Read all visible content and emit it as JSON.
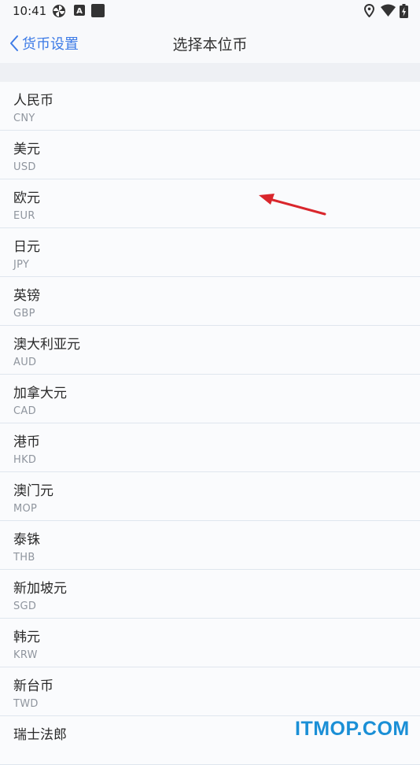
{
  "status": {
    "time": "10:41",
    "icons": [
      "pinwheel-icon",
      "a-badge-icon",
      "square-icon",
      "location-icon",
      "wifi-icon",
      "battery-charging-icon"
    ]
  },
  "nav": {
    "back_label": "货币设置",
    "title": "选择本位币"
  },
  "currencies": [
    {
      "name": "人民币",
      "code": "CNY"
    },
    {
      "name": "美元",
      "code": "USD"
    },
    {
      "name": "欧元",
      "code": "EUR"
    },
    {
      "name": "日元",
      "code": "JPY"
    },
    {
      "name": "英镑",
      "code": "GBP"
    },
    {
      "name": "澳大利亚元",
      "code": "AUD"
    },
    {
      "name": "加拿大元",
      "code": "CAD"
    },
    {
      "name": "港币",
      "code": "HKD"
    },
    {
      "name": "澳门元",
      "code": "MOP"
    },
    {
      "name": "泰铢",
      "code": "THB"
    },
    {
      "name": "新加坡元",
      "code": "SGD"
    },
    {
      "name": "韩元",
      "code": "KRW"
    },
    {
      "name": "新台币",
      "code": "TWD"
    },
    {
      "name": "瑞士法郎",
      "code": ""
    }
  ],
  "annotation": {
    "arrow_color": "#d9262c",
    "icon": "red-arrow-icon"
  },
  "watermark": "ITMOP.COM",
  "colors": {
    "accent": "#3d7be6",
    "watermark": "#1a8fd6"
  }
}
